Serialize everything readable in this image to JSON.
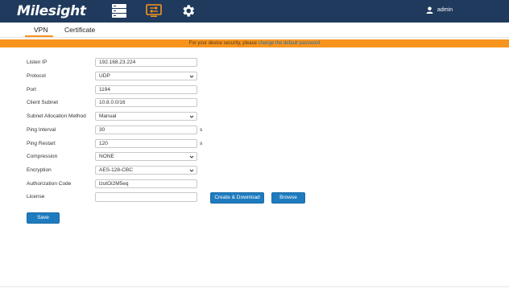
{
  "app": {
    "logo_text": "Milesight",
    "user_name": "admin"
  },
  "nav_icons": [
    "status-icon",
    "network-icon",
    "settings-icon"
  ],
  "tabs": [
    {
      "label": "VPN",
      "active": true
    },
    {
      "label": "Certificate",
      "active": false
    }
  ],
  "banner": {
    "text": "For your device security, please ",
    "link": "change the default password"
  },
  "form": {
    "listen_ip": {
      "label": "Listen IP",
      "value": "192.168.23.224"
    },
    "protocol": {
      "label": "Protocol",
      "value": "UDP"
    },
    "port": {
      "label": "Port",
      "value": "1194"
    },
    "client_subnet": {
      "label": "Client Subnet",
      "value": "10.8.0.0/16"
    },
    "subnet_allocation": {
      "label": "Subnet Allocation Method",
      "value": "Manual"
    },
    "ping_interval": {
      "label": "Ping Interval",
      "value": "30",
      "unit": "s"
    },
    "ping_restart": {
      "label": "Ping Restart",
      "value": "120",
      "unit": "s"
    },
    "compression": {
      "label": "Compression",
      "value": "NONE"
    },
    "encryption": {
      "label": "Encryption",
      "value": "AES-128-CBC"
    },
    "authorization_code": {
      "label": "Authorization Code",
      "value": "lzutOi2M5eq"
    },
    "license": {
      "label": "License",
      "value": ""
    }
  },
  "buttons": {
    "create_download": "Create & Download",
    "browse": "Browse",
    "save": "Save"
  },
  "colors": {
    "header_bg": "#1f3a5c",
    "accent_orange": "#f7941d",
    "button_blue": "#1e7bbf"
  }
}
